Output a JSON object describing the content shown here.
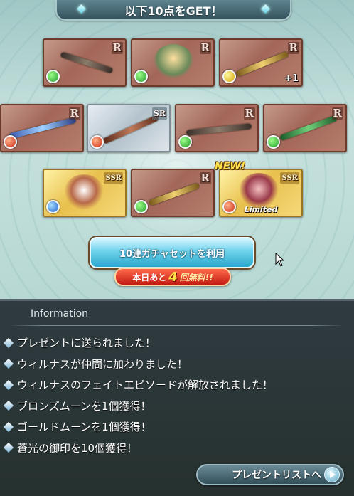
{
  "banner": {
    "title": "以下10点をGET！"
  },
  "items": [
    {
      "rarity": "R",
      "element": "wind"
    },
    {
      "rarity": "R",
      "element": "wind"
    },
    {
      "rarity": "R",
      "element": "light",
      "count": "+1"
    },
    {
      "rarity": "R",
      "element": "fire"
    },
    {
      "rarity": "SR",
      "element": "fire"
    },
    {
      "rarity": "R",
      "element": "wind"
    },
    {
      "rarity": "R",
      "element": "wind"
    },
    {
      "rarity": "SSR",
      "element": "water"
    },
    {
      "rarity": "R",
      "element": "wind"
    },
    {
      "rarity": "SSR",
      "element": "fire",
      "badge": "NEW!",
      "tag": "Limited"
    }
  ],
  "gacha": {
    "button_label": "10連ガチャセットを利用",
    "free_prefix": "本日あと",
    "free_count": "4",
    "free_suffix": "回無料!!"
  },
  "info": {
    "header": "Information",
    "messages": [
      "プレゼントに送られました！",
      "ウィルナスが仲間に加わりました！",
      "ウィルナスのフェイトエピソードが解放されました！",
      "ブロンズムーンを1個獲得！",
      "ゴールドムーンを1個獲得！",
      "蒼光の御印を10個獲得！"
    ],
    "present_list_label": "プレゼントリストへ"
  },
  "colors": {
    "accent": "#2ba8cc",
    "badge_red": "#c21a12",
    "panel_bg": "#2f3b40"
  }
}
